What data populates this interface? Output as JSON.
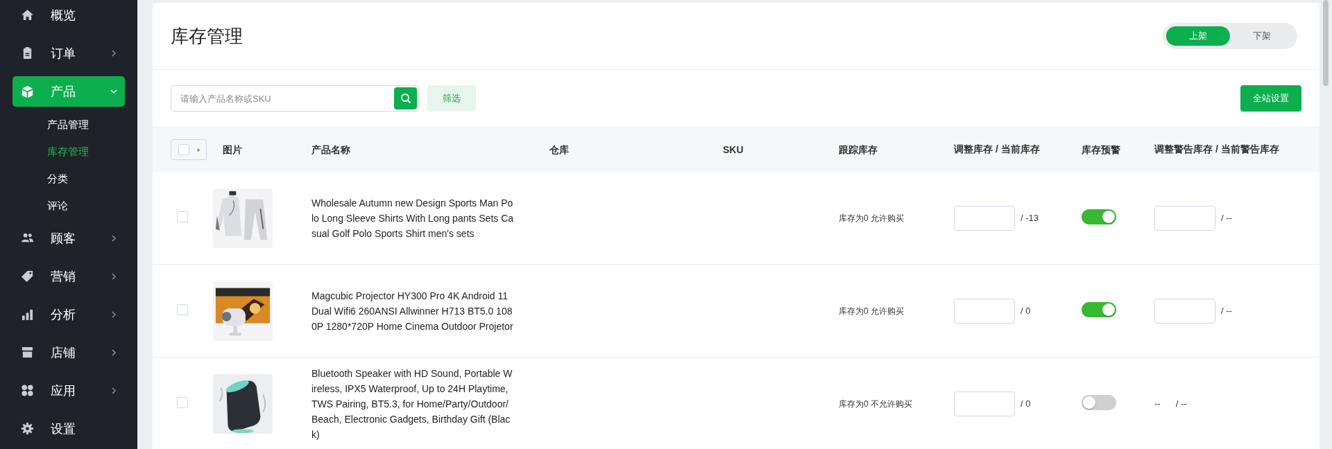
{
  "sidebar": {
    "items": [
      {
        "label": "概览",
        "selected": false
      },
      {
        "label": "订单",
        "expanded": false,
        "selected": false
      },
      {
        "label": "产品",
        "expanded": true,
        "selected": true,
        "children": [
          {
            "label": "产品管理",
            "selected": false
          },
          {
            "label": "库存管理",
            "selected": true
          },
          {
            "label": "分类",
            "selected": false
          },
          {
            "label": "评论",
            "selected": false
          }
        ]
      },
      {
        "label": "顾客",
        "expanded": false,
        "selected": false
      },
      {
        "label": "营销",
        "expanded": false,
        "selected": false
      },
      {
        "label": "分析",
        "expanded": false,
        "selected": false
      },
      {
        "label": "店铺",
        "expanded": false,
        "selected": false
      },
      {
        "label": "应用",
        "expanded": false,
        "selected": false
      },
      {
        "label": "设置",
        "selected": false
      }
    ]
  },
  "page": {
    "title": "库存管理",
    "status_tabs": [
      {
        "label": "上架",
        "selected": true
      },
      {
        "label": "下架",
        "selected": false
      }
    ]
  },
  "toolbar": {
    "search": {
      "placeholder": "请输入产品名称或SKU"
    },
    "filter_button": "筛选",
    "settings_button": "全站设置"
  },
  "table": {
    "columns": [
      "图片",
      "产品名称",
      "仓库",
      "SKU",
      "跟踪库存",
      "调整库存 / 当前库存",
      "库存预警",
      "调整警告库存 / 当前警告库存"
    ],
    "rows": [
      {
        "checked": false,
        "name": "Wholesale Autumn new Design Sports Man Polo Long Sleeve Shirts With Long pants Sets Casual Golf Polo Sports Shirt men's sets",
        "tracking": "库存为0 允许购买",
        "stock": "/ -13",
        "alert": true,
        "warn_current": "/ --"
      },
      {
        "checked": false,
        "name": "Magcubic Projector HY300 Pro 4K Android 11 Dual Wifi6 260ANSI Allwinner H713 BT5.0 1080P 1280*720P Home Cinema Outdoor Projetor",
        "tracking": "库存为0 允许购买",
        "stock": "/ 0",
        "alert": true,
        "warn_current": "/ --"
      },
      {
        "checked": false,
        "name": "Bluetooth Speaker with HD Sound, Portable Wireless, IPX5 Waterproof, Up to 24H Playtime, TWS Pairing, BT5.3, for Home/Party/Outdoor/Beach, Electronic Gadgets, Birthday Gift (Black)",
        "tracking": "库存为0 不允许购买",
        "stock": "/ 0",
        "alert": false,
        "warn_text": "--",
        "warn_current": "/ --"
      }
    ]
  }
}
